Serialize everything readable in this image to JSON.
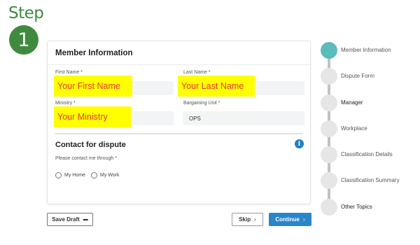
{
  "step": {
    "word": "Step",
    "number": "1"
  },
  "form": {
    "section_title": "Member Information",
    "first_name": {
      "label": "First Name *",
      "value": "",
      "highlight": "Your First Name"
    },
    "last_name": {
      "label": "Last Name *",
      "value": "",
      "highlight": "Your Last Name"
    },
    "ministry": {
      "label": "Ministry *",
      "value": "",
      "highlight": "Your Ministry"
    },
    "bargaining_unit": {
      "label": "Bargaining Unit *",
      "value": "OPS"
    },
    "contact_title": "Contact for dispute",
    "contact_prompt": "Please contact me through *",
    "contact_options": [
      "My Home",
      "My Work"
    ],
    "info_icon": "info-icon"
  },
  "buttons": {
    "save_draft": "Save Draft",
    "save_draft_icon": "folder-icon",
    "skip": "Skip",
    "continue": "Continue"
  },
  "stepper": {
    "active_index": 0,
    "steps": [
      {
        "label": "Member Information"
      },
      {
        "label": "Dispute Form"
      },
      {
        "label": "Manager"
      },
      {
        "label": "Workplace"
      },
      {
        "label": "Classification Details"
      },
      {
        "label": "Classification Summary"
      },
      {
        "label": "Other Topics"
      }
    ]
  },
  "colors": {
    "step_green": "#3f8a3f",
    "accent_blue": "#2a86c9",
    "highlight_yellow": "#ffff00",
    "highlight_text_red": "#e53935",
    "active_step_teal": "#5bbdbb"
  }
}
